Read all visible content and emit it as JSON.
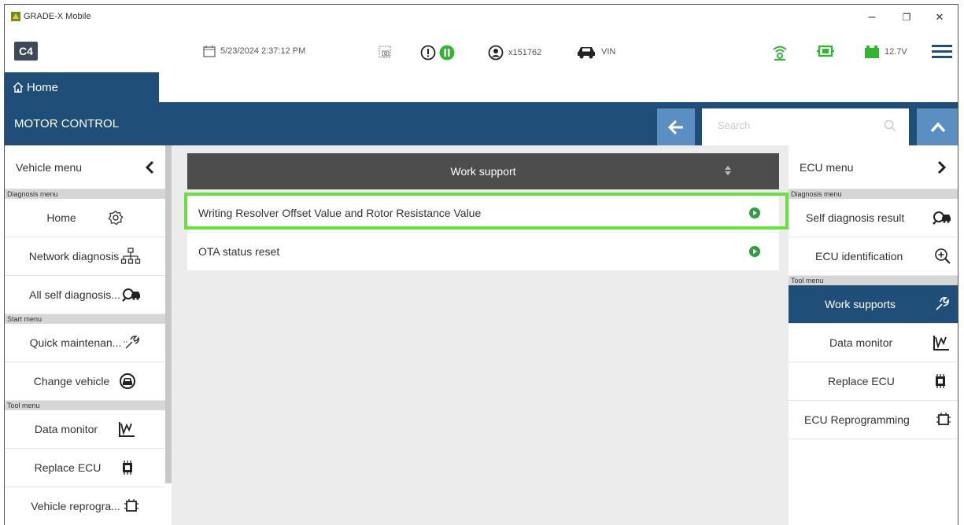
{
  "window": {
    "title": "GRADE-X Mobile",
    "controls": {
      "minimize": "–",
      "maximize": "❐",
      "close": "✕"
    }
  },
  "toolbar": {
    "logo": "C4",
    "datetime": "5/23/2024 2:37:12 PM",
    "user": "x151762",
    "vin": "VIN",
    "voltage": "12.7V"
  },
  "tabs": {
    "home": "Home"
  },
  "module": {
    "title": "MOTOR CONTROL",
    "search_placeholder": "Search"
  },
  "left_panel": {
    "header": "Vehicle menu",
    "sections": {
      "diagnosis": "Diagnosis menu",
      "start": "Start menu",
      "tool": "Tool menu"
    },
    "items": {
      "home": "Home",
      "network_diagnosis": "Network diagnosis",
      "all_self_diagnosis": "All self diagnosis...",
      "quick_maintenance": "Quick maintenan...",
      "change_vehicle": "Change vehicle",
      "data_monitor": "Data monitor",
      "replace_ecu": "Replace ECU",
      "vehicle_reprogramming": "Vehicle reprogra..."
    }
  },
  "work_support": {
    "header": "Work support",
    "rows": [
      {
        "label": "Writing Resolver Offset Value and Rotor Resistance Value",
        "selected": true
      },
      {
        "label": "OTA status reset",
        "selected": false
      }
    ]
  },
  "right_panel": {
    "header": "ECU menu",
    "sections": {
      "diagnosis": "Diagnosis menu",
      "tool": "Tool menu"
    },
    "items": {
      "self_diagnosis_result": "Self diagnosis result",
      "ecu_identification": "ECU identification",
      "work_supports": "Work supports",
      "data_monitor": "Data monitor",
      "replace_ecu": "Replace ECU",
      "ecu_reprogramming": "ECU Reprogramming"
    }
  },
  "colors": {
    "nav_blue": "#1f4e79",
    "button_blue": "#5b8ec1",
    "highlight_green": "#66e33a",
    "play_green": "#2e9e3e",
    "status_green": "#2fb82f"
  }
}
